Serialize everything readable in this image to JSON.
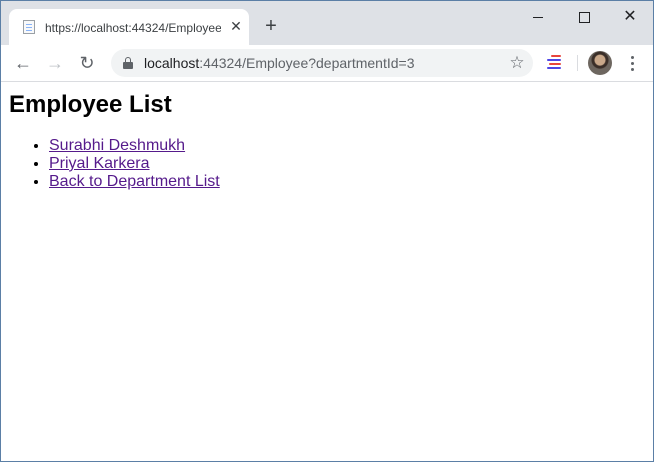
{
  "browser": {
    "tab_title": "https://localhost:44324/Employee",
    "tab_close": "✕",
    "new_tab": "+",
    "url_host": "localhost",
    "url_rest": ":44324/Employee?departmentId=3"
  },
  "icons": {
    "back": "←",
    "forward": "→",
    "reload": "↻",
    "star": "☆",
    "close": "✕"
  },
  "page": {
    "heading": "Employee List",
    "links": [
      "Surabhi Deshmukh",
      "Priyal Karkera",
      "Back to Department List"
    ]
  },
  "colors": {
    "visited_link": "#551a8b",
    "titlebar": "#dee1e6",
    "omnibox": "#f1f3f4"
  }
}
